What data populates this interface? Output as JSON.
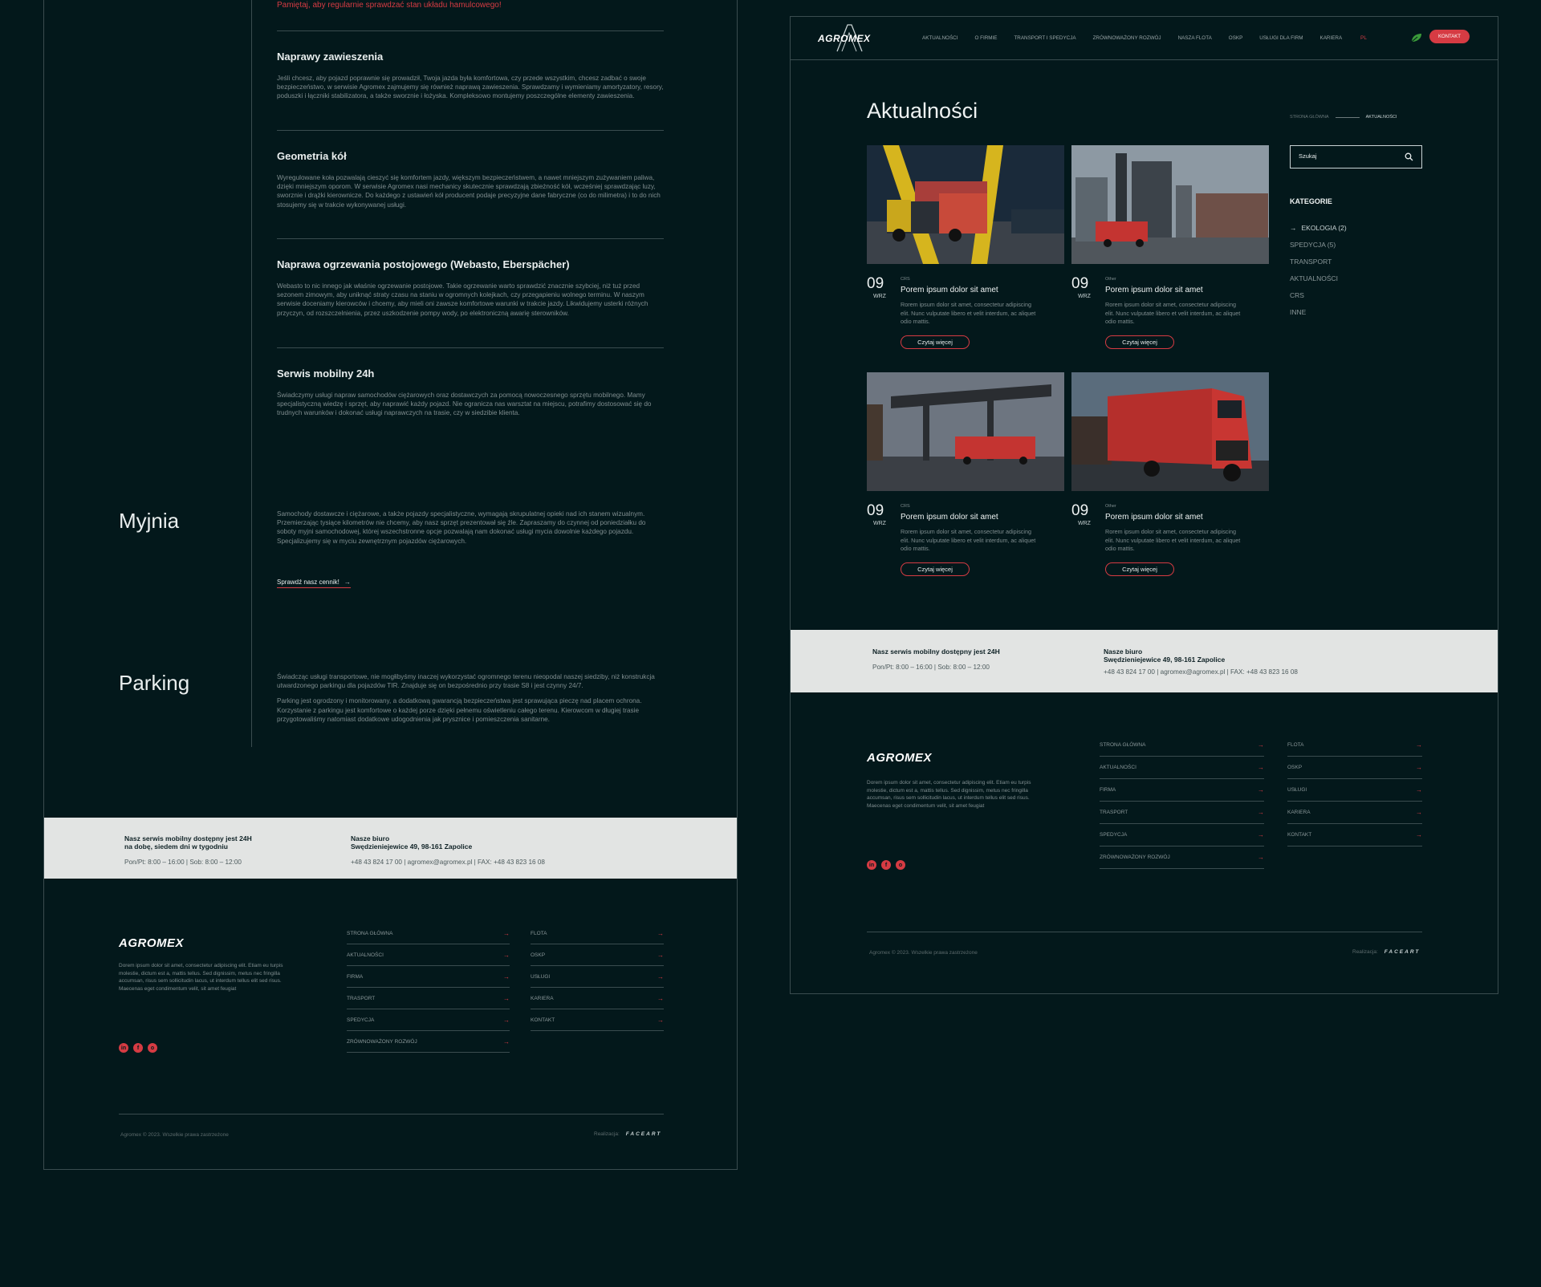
{
  "left": {
    "warning": "Pamiętaj, aby regularnie sprawdzać stan układu hamulcowego!",
    "services": [
      {
        "title": "Naprawy zawieszenia",
        "text": "Jeśli chcesz, aby pojazd poprawnie się prowadził, Twoja jazda była komfortowa, czy przede wszystkim, chcesz zadbać o swoje bezpieczeństwo, w serwisie Agromex zajmujemy się również naprawą zawieszenia. Sprawdzamy i wymieniamy amortyzatory, resory, poduszki i łączniki stabilizatora, a także sworznie i łożyska. Kompleksowo montujemy poszczególne elementy zawieszenia."
      },
      {
        "title": "Geometria kół",
        "text": "Wyregulowane koła pozwalają cieszyć się komfortem jazdy, większym bezpieczeństwem, a nawet mniejszym zużywaniem paliwa, dzięki mniejszym oporom. W serwisie Agromex nasi mechanicy skutecznie sprawdzają zbieżność kół, wcześniej sprawdzając luzy, sworznie i drążki kierownicze. Do każdego z ustawień kół producent podaje precyzyjne dane fabryczne (co do milimetra) i to do nich stosujemy się w trakcie wykonywanej usługi."
      },
      {
        "title": "Naprawa ogrzewania postojowego (Webasto, Eberspächer)",
        "text": "Webasto to nic innego jak właśnie ogrzewanie postojowe. Takie ogrzewanie warto sprawdzić znacznie szybciej, niż tuż przed sezonem zimowym, aby uniknąć straty czasu na staniu w ogromnych kolejkach, czy przegapieniu wolnego terminu. W naszym serwisie doceniamy kierowców i chcemy, aby mieli oni zawsze komfortowe warunki w trakcie jazdy. Likwidujemy usterki różnych przyczyn, od rozszczelnienia, przez uszkodzenie pompy wody, po elektroniczną awarię sterowników."
      },
      {
        "title": "Serwis mobilny 24h",
        "text": "Świadczymy usługi napraw samochodów ciężarowych oraz dostawczych za pomocą nowoczesnego sprzętu mobilnego. Mamy specjalistyczną wiedzę i sprzęt, aby naprawić każdy pojazd. Nie ogranicza nas warsztat na miejscu, potrafimy dostosować się do trudnych warunków i dokonać usługi naprawczych na trasie, czy w siedzibie klienta."
      }
    ],
    "myjnia": {
      "label": "Myjnia",
      "text": "Samochody dostawcze i ciężarowe, a także pojazdy specjalistyczne, wymagają skrupulatnej opieki nad ich stanem wizualnym. Przemierzając tysiące kilometrów nie chcemy, aby nasz sprzęt prezentował się źle. Zapraszamy do czynnej od poniedziałku do soboty myjni samochodowej, której wszechstronne opcje pozwalają nam dokonać usługi mycia dowolnie każdego pojazdu. Specjalizujemy się w myciu zewnętrznym pojazdów ciężarowych.",
      "link": "Sprawdź nasz cennik!"
    },
    "parking": {
      "label": "Parking",
      "p1": "Świadcząc usługi transportowe, nie mogłibyśmy inaczej wykorzystać ogromnego terenu nieopodal naszej siedziby, niż konstrukcja utwardzonego parkingu dla pojazdów TIR. Znajduje się on bezpośrednio przy trasie S8 i jest czynny 24/7.",
      "p2": "Parking jest ogrodzony i monitorowany, a dodatkową gwarancją bezpieczeństwa jest sprawująca pieczę nad placem ochrona. Korzystanie z parkingu jest komfortowe o każdej porze dzięki pełnemu oświetleniu całego terenu. Kierowcom w długiej trasie przygotowaliśmy natomiast dodatkowe udogodnienia jak prysznice i pomieszczenia sanitarne."
    },
    "band": {
      "mobile_title_1": "Nasz serwis mobilny dostępny jest 24H",
      "mobile_title_2": "na dobę, siedem dni w tygodniu",
      "hours": "Pon/Pt: 8:00 – 16:00    |    Sob: 8:00 – 12:00",
      "office_title_1": "Nasze biuro",
      "office_title_2": "Swędzieniejewice 49, 98-161 Zapolice",
      "contact": "+48 43 824 17 00   |   agromex@agromex.pl   |   FAX: +48 43 823 16 08"
    }
  },
  "footer": {
    "logo": "AGROMEX",
    "desc": "Dorem ipsum dolor sit amet, consectetur adipiscing elit. Etiam eu turpis molestie, dictum est a, mattis tellus. Sed dignissim, metus nec fringilla accumsan, risus sem sollicitudin lacus, ut interdum tellus elit sed risus. Maecenas eget condimentum velit, sit amet feugiat",
    "col1": [
      "STRONA GŁÓWNA",
      "AKTUALNOŚCI",
      "FIRMA",
      "TRASPORT",
      "SPEDYCJA",
      "ZRÓWNOWAŻONY ROZWÓJ"
    ],
    "col2": [
      "FLOTA",
      "OSKP",
      "USŁUGI",
      "KARIERA",
      "KONTAKT"
    ],
    "social": [
      "in",
      "f",
      "o"
    ],
    "copyright": "Agromex © 2023. Wszelkie prawa zastrzeżone",
    "realizacja": "Realizacja:",
    "realizacja_brand": "FACEART"
  },
  "right": {
    "nav": [
      "AKTUALNOŚCI",
      "O FIRMIE",
      "TRANSPORT I SPEDYCJA",
      "ZRÓWNOWAŻONY ROZWÓJ",
      "NASZA FLOTA",
      "OSKP",
      "USŁUGI DLA FIRM",
      "KARIERA"
    ],
    "lang": "PL",
    "kontakt": "KONTAKT",
    "title": "Aktualności",
    "crumb_home": "STRONA GŁÓWNA",
    "crumb_current": "AKTUALNOŚCI",
    "search_placeholder": "Szukaj",
    "categories_title": "KATEGORIE",
    "categories": [
      "EKOLOGIA (2)",
      "SPEDYCJA (5)",
      "TRANSPORT",
      "AKTUALNOŚCI",
      "CRS",
      "INNE"
    ],
    "read_more": "Czytaj więcej",
    "posts": [
      {
        "day": "09",
        "month": "WRZ",
        "cat": "CRS",
        "title": "Porem ipsum dolor sit amet",
        "text": "Rorem ipsum dolor sit amet, consectetur adipiscing elit. Nunc vulputate libero et velit interdum, ac aliquet odio mattis."
      },
      {
        "day": "09",
        "month": "WRZ",
        "cat": "Other",
        "title": "Porem ipsum dolor sit amet",
        "text": "Rorem ipsum dolor sit amet, consectetur adipiscing elit. Nunc vulputate libero et velit interdum, ac aliquet odio mattis."
      },
      {
        "day": "09",
        "month": "WRZ",
        "cat": "CRS",
        "title": "Porem ipsum dolor sit amet",
        "text": "Rorem ipsum dolor sit amet, consectetur adipiscing elit. Nunc vulputate libero et velit interdum, ac aliquet odio mattis."
      },
      {
        "day": "09",
        "month": "WRZ",
        "cat": "Other",
        "title": "Porem ipsum dolor sit amet",
        "text": "Rorem ipsum dolor sit amet, consectetur adipiscing elit. Nunc vulputate libero et velit interdum, ac aliquet odio mattis."
      }
    ],
    "band": {
      "mobile_title": "Nasz serwis mobilny dostępny jest 24H",
      "hours": "Pon/Pt: 8:00 – 16:00    |    Sob: 8:00 – 12:00",
      "office_title_1": "Nasze biuro",
      "office_title_2": "Swędzieniejewice 49, 98-161 Zapolice",
      "contact": "+48 43 824 17 00   |   agromex@agromex.pl   |   FAX: +48 43 823 16 08"
    }
  },
  "colors": {
    "background": "#03181b",
    "accent": "#d63b43",
    "band": "#e2e4e3"
  }
}
